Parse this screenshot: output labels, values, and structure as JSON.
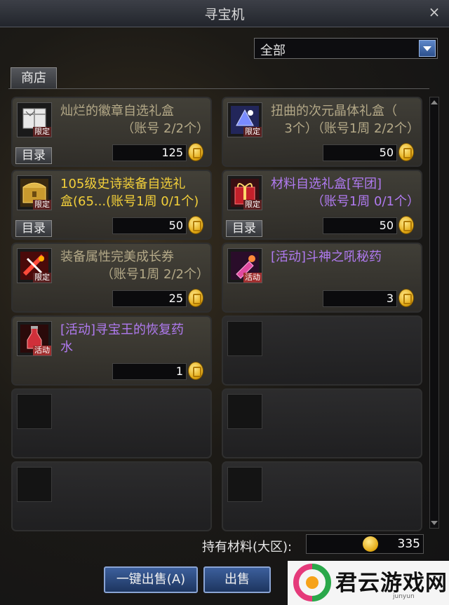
{
  "window": {
    "title": "寻宝机",
    "close_symbol": "×"
  },
  "filter": {
    "selected": "全部"
  },
  "tabs": [
    {
      "label": "商店"
    }
  ],
  "items": [
    {
      "name_line1": "灿烂的徽章自选礼盒",
      "name_line2": "（账号 2/2个）",
      "name_color": "gray",
      "tag": "限定",
      "catalog_label": "目录",
      "price": "125",
      "icon": "badge-box-icon"
    },
    {
      "name_line1": "扭曲的次元晶体礼盒（",
      "name_line2": "3个）（账号1周 2/2个）",
      "name_color": "gray",
      "tag": "限定",
      "catalog_label": "",
      "price": "50",
      "icon": "crystal-box-icon"
    },
    {
      "name_line1": "105级史诗装备自选礼",
      "name_line2": "盒(65...(账号1周 0/1个)",
      "name_color": "gold",
      "tag": "限定",
      "catalog_label": "目录",
      "price": "50",
      "icon": "epic-chest-icon"
    },
    {
      "name_line1": "材料自选礼盒[军团]",
      "name_line2": "（账号1周 0/1个）",
      "name_color": "purple",
      "tag": "限定",
      "catalog_label": "目录",
      "price": "50",
      "icon": "gift-box-icon"
    },
    {
      "name_line1": "装备属性完美成长券",
      "name_line2": "（账号1周 2/2个）",
      "name_color": "gray",
      "tag": "限定",
      "catalog_label": "",
      "price": "25",
      "icon": "growth-ticket-icon"
    },
    {
      "name_line1": "[活动]斗神之吼秘药",
      "name_line2": "",
      "name_color": "purple",
      "tag": "活动",
      "catalog_label": "",
      "price": "3",
      "icon": "potion-icon"
    },
    {
      "name_line1": "[活动]寻宝王的恢复药",
      "name_line2": "水",
      "name_color": "purple",
      "tag": "活动",
      "catalog_label": "",
      "price": "1",
      "icon": "recovery-potion-icon"
    }
  ],
  "material": {
    "label": "持有材料(大区):",
    "amount": "335"
  },
  "buttons": {
    "sell_all": "一键出售(A)",
    "sell": "出售"
  },
  "watermark": {
    "text": "君云游戏网",
    "sub": "junyun"
  }
}
